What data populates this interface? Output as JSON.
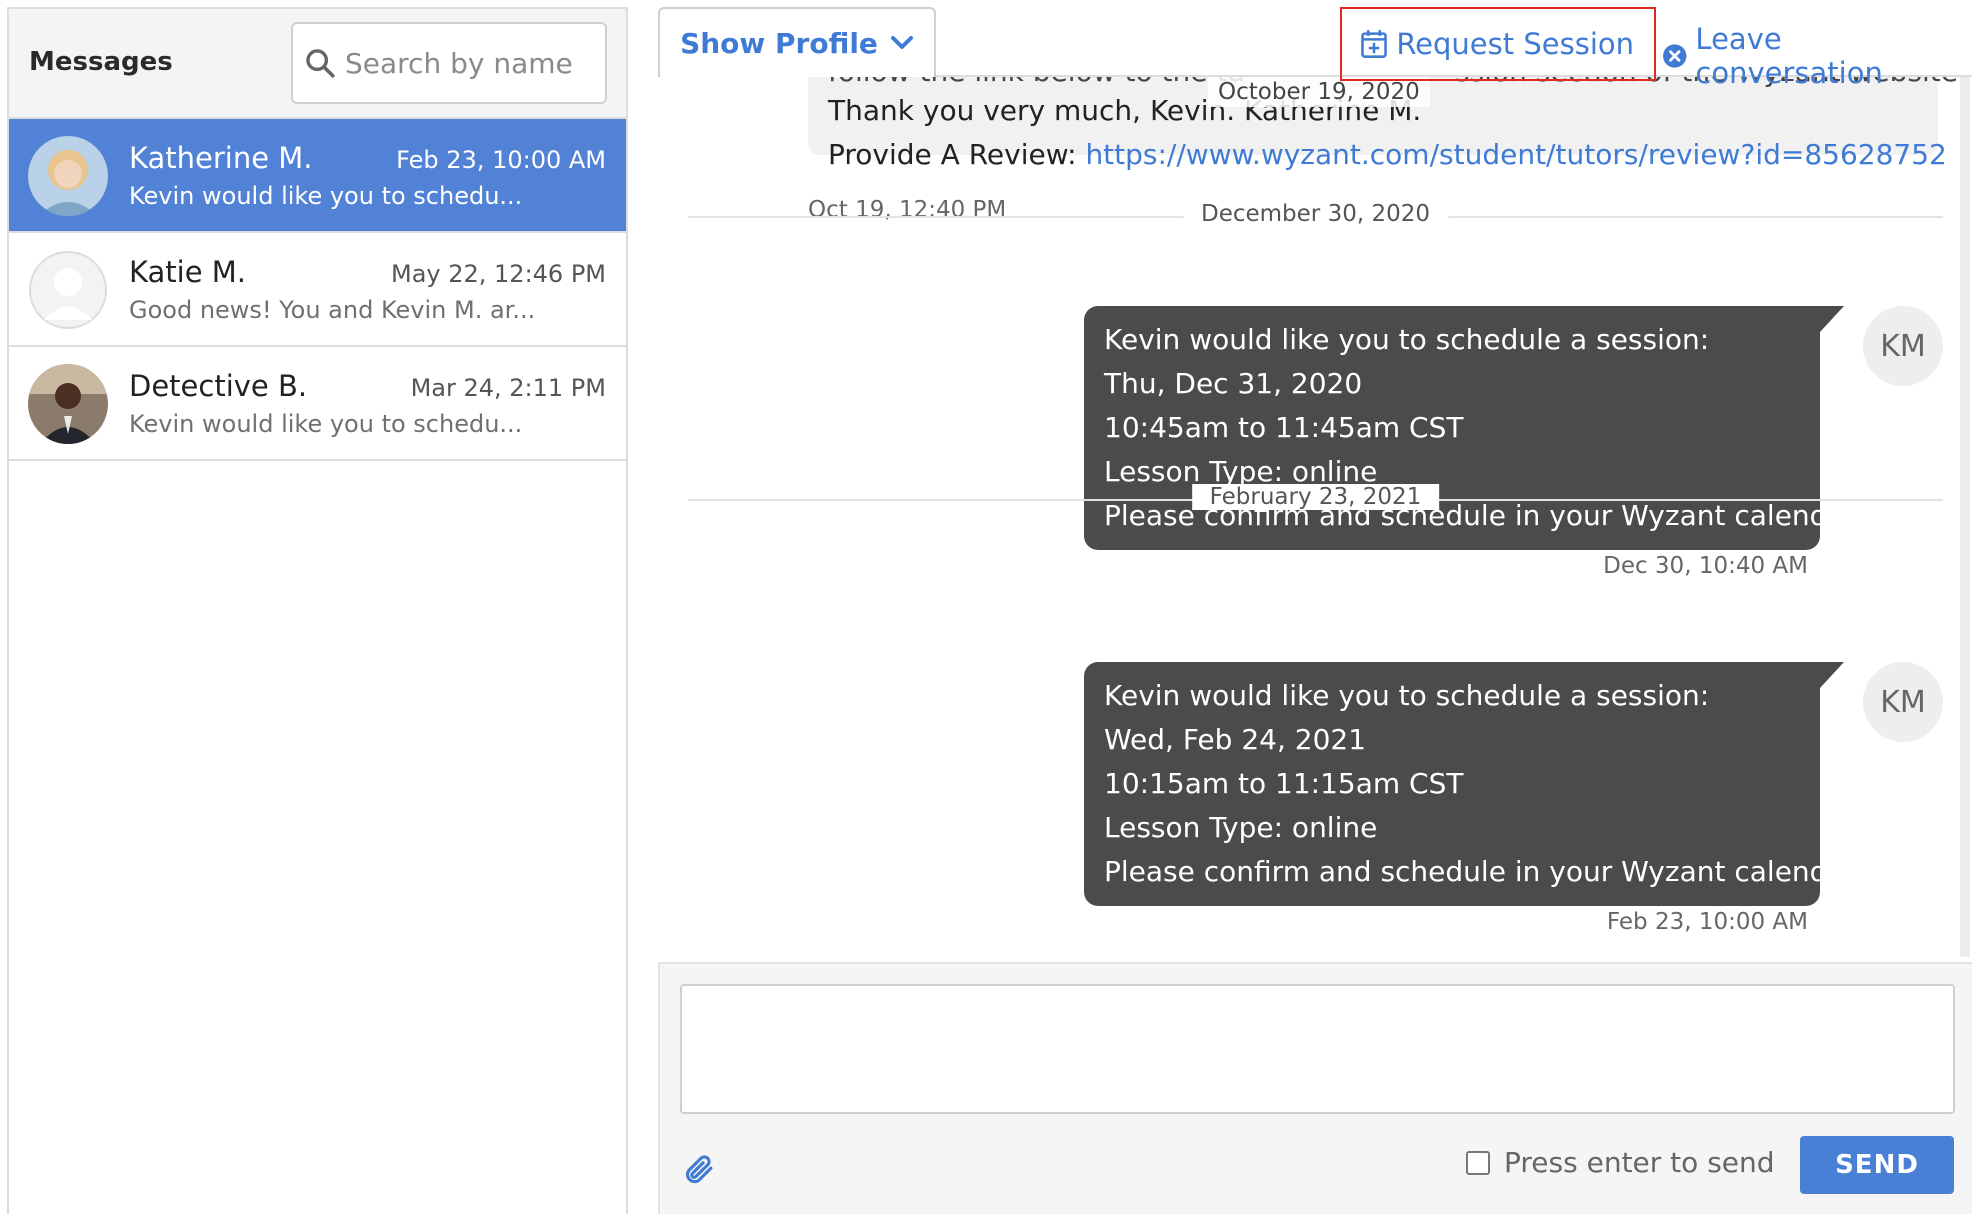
{
  "sidebar": {
    "title": "Messages",
    "search": {
      "placeholder": "Search by name",
      "value": ""
    },
    "conversations": [
      {
        "name": "Katherine M.",
        "time": "Feb 23, 10:00 AM",
        "preview": "Kevin would like you to schedu...",
        "active": true,
        "avatar": "photo-avatar"
      },
      {
        "name": "Katie M.",
        "time": "May 22, 12:46 PM",
        "preview": "Good news! You and Kevin M. ar...",
        "active": false,
        "avatar": "default-avatar"
      },
      {
        "name": "Detective B.",
        "time": "Mar 24, 2:11 PM",
        "preview": "Kevin would like you to schedu...",
        "active": false,
        "avatar": "photo-avatar"
      }
    ]
  },
  "header": {
    "show_profile_label": "Show Profile",
    "request_session_label": "Request Session",
    "leave_conversation_label": "Leave conversation",
    "floating_date": "October 19, 2020"
  },
  "thread": {
    "old_message": {
      "line1_cut": "follow the link below to the tu",
      "line1_tail": "ssion section of the Wyzant website.",
      "line2": "Thank you very much, Kevin. Katherine M.",
      "line3_prefix": "Provide A Review: ",
      "line3_link": "https://www.wyzant.com/student/tutors/review?id=85628752",
      "time": "Oct 19, 12:40 PM"
    },
    "groups": [
      {
        "date": "December 30, 2020",
        "avatar_initials": "KM",
        "lines": [
          "Kevin would like you to schedule a session:",
          "Thu, Dec 31, 2020",
          "10:45am to 11:45am CST",
          "Lesson Type: online",
          "Please confirm and schedule in your Wyzant calendar"
        ],
        "time": "Dec 30, 10:40 AM"
      },
      {
        "date": "February 23, 2021",
        "avatar_initials": "KM",
        "lines": [
          "Kevin would like you to schedule a session:",
          "Wed, Feb 24, 2021",
          "10:15am to 11:15am CST",
          "Lesson Type: online",
          "Please confirm and schedule in your Wyzant calendar"
        ],
        "time": "Feb 23, 10:00 AM"
      }
    ]
  },
  "composer": {
    "value": "",
    "press_enter_label": "Press enter to send",
    "press_enter_checked": false,
    "send_label": "SEND"
  },
  "colors": {
    "accent": "#3f7bd4",
    "active_row": "#5282d6",
    "bubble": "#4b4b4b",
    "highlight_box": "#e02a20"
  }
}
